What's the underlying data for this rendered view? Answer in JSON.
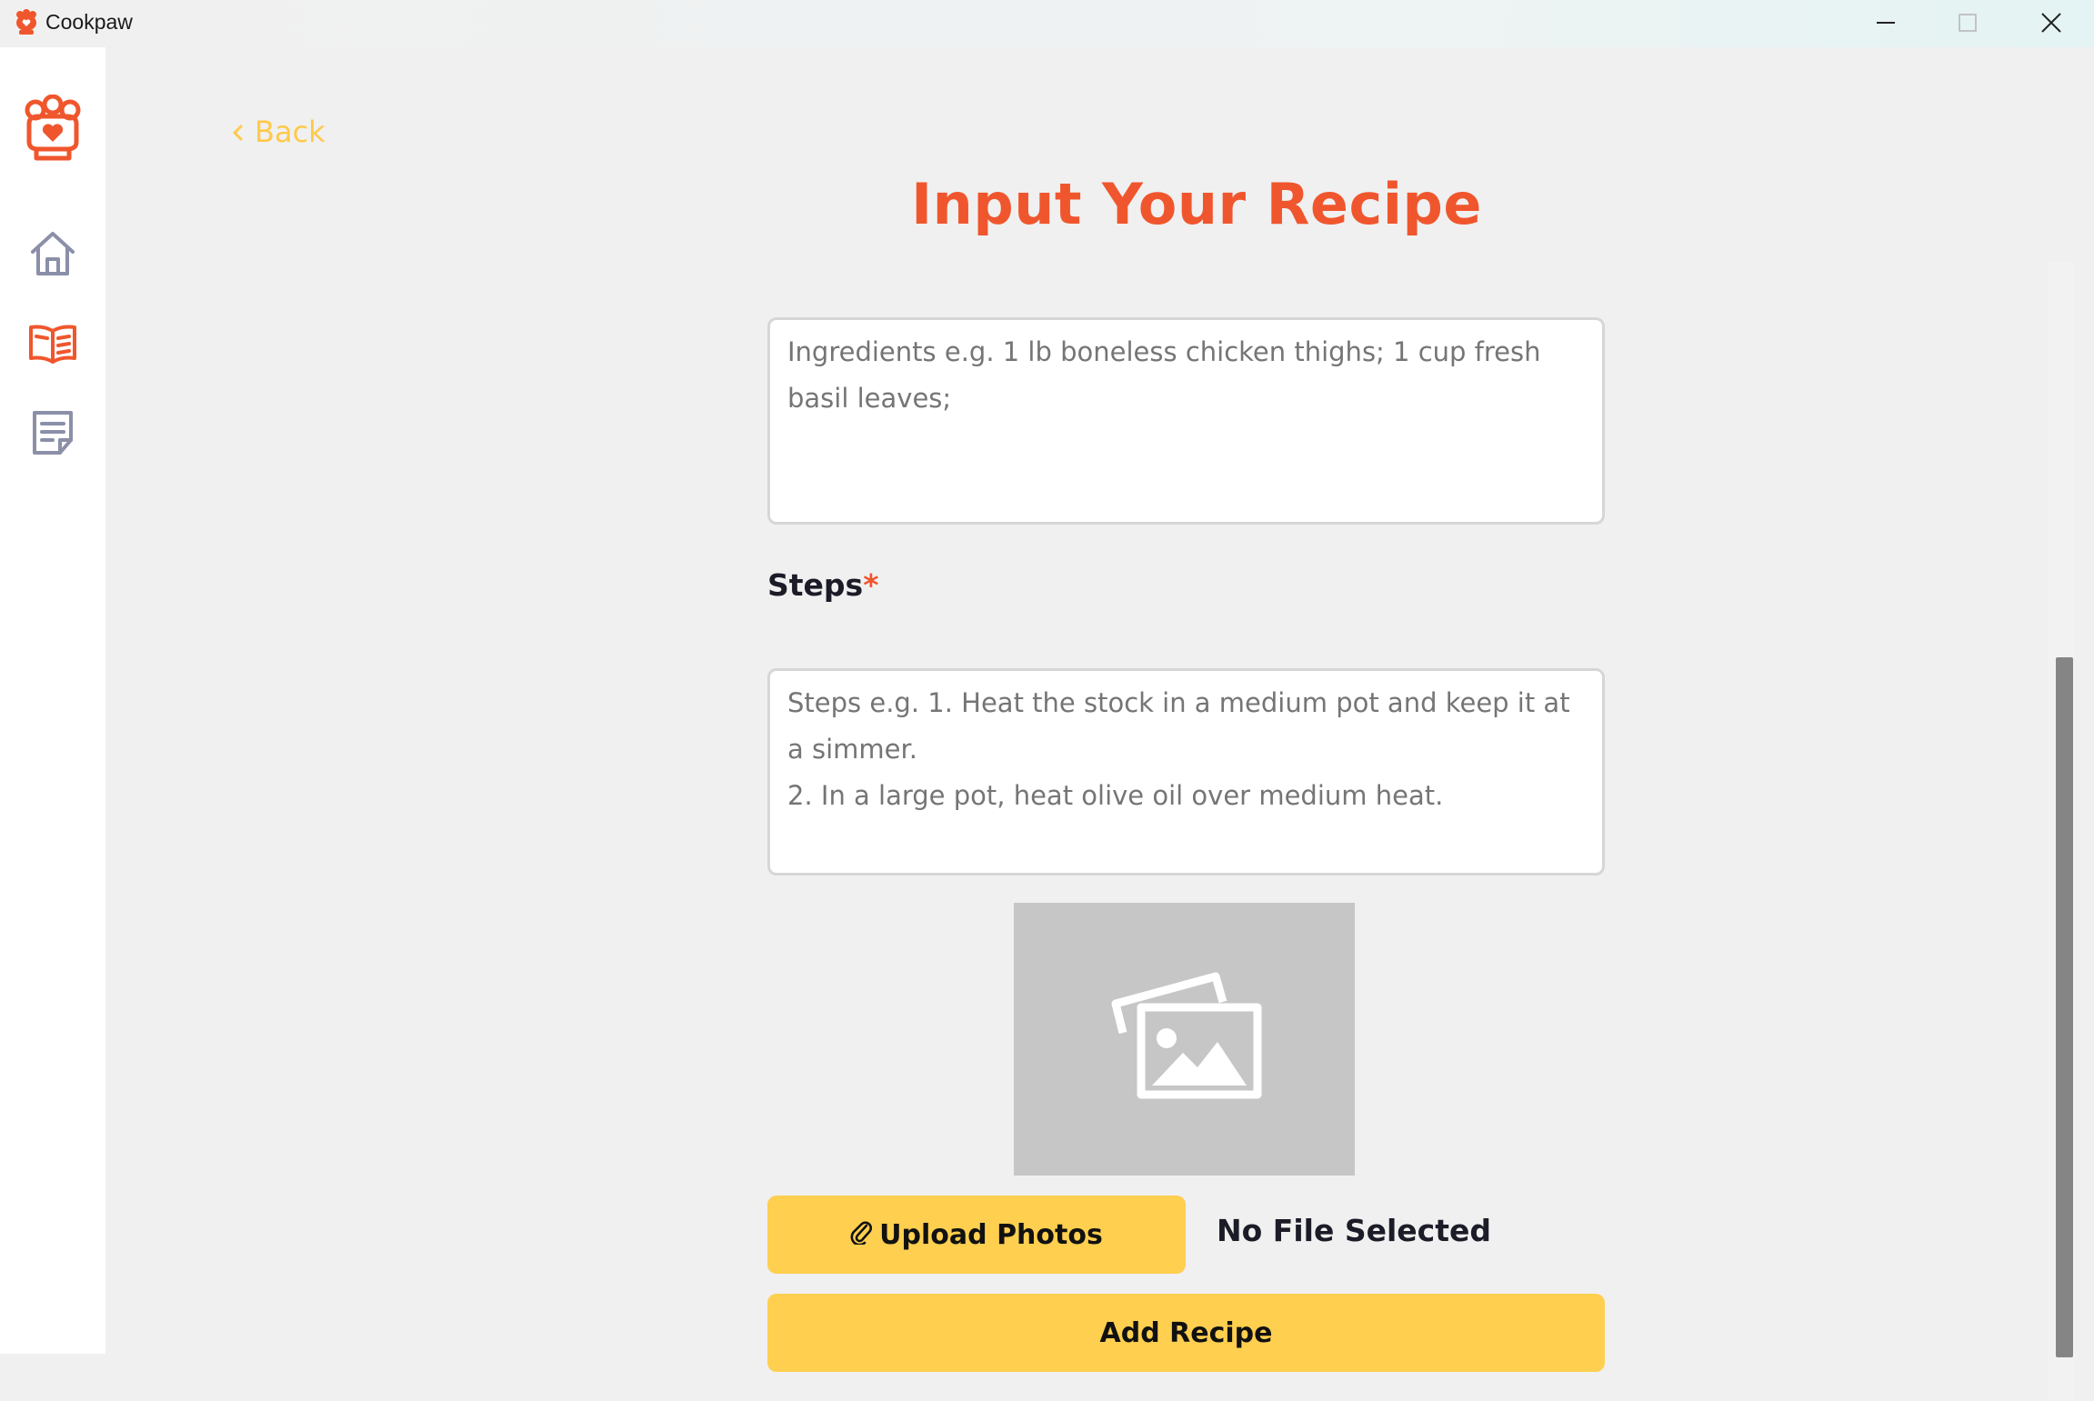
{
  "window": {
    "title": "Cookpaw"
  },
  "sidebar": {
    "items": [
      {
        "icon": "home-icon",
        "color": "#8b8fa8"
      },
      {
        "icon": "recipe-book-icon",
        "color": "#f0562d"
      },
      {
        "icon": "notes-icon",
        "color": "#8b8fa8"
      }
    ]
  },
  "nav": {
    "back_label": "Back"
  },
  "page": {
    "title": "Input Your Recipe"
  },
  "form": {
    "ingredients_placeholder": "Ingredients e.g. 1 lb boneless chicken thighs; 1 cup fresh basil leaves;",
    "steps_label": "Steps",
    "steps_required_mark": "*",
    "steps_placeholder": "Steps e.g. 1. Heat the stock in a medium pot and keep it at a simmer.\n2. In a large pot, heat olive oil over medium heat.",
    "upload_label": "Upload Photos",
    "file_status": "No File Selected",
    "submit_label": "Add Recipe"
  },
  "colors": {
    "accent_orange": "#f0562d",
    "accent_yellow": "#ffcf4f",
    "back_link": "#ffc94a"
  }
}
